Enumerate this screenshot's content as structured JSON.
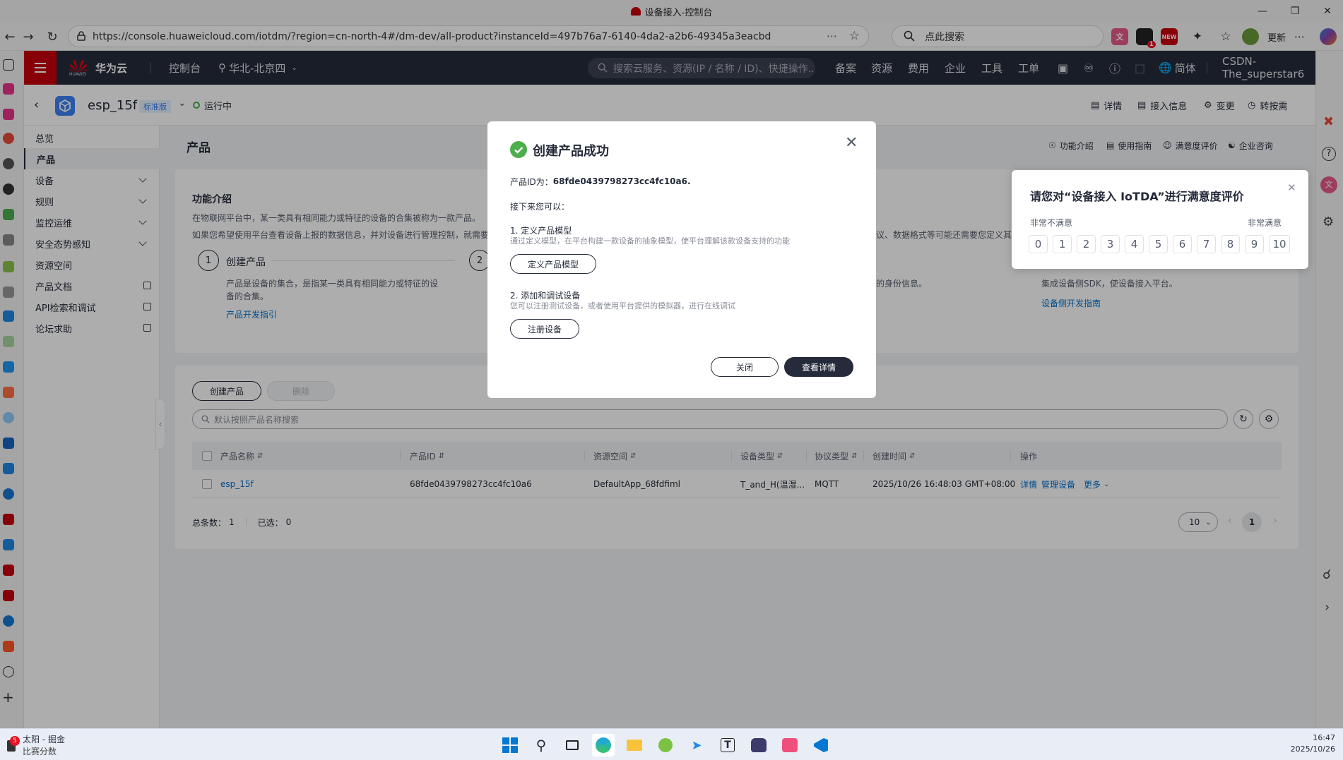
{
  "window": {
    "title": "设备接入-控制台"
  },
  "browser": {
    "url": "https://console.huaweicloud.com/iotdm/?region=cn-north-4#/dm-dev/all-product?instanceId=497b76a7-6140-4da2-a2b6-49345a3eacbd",
    "search_placeholder": "点此搜索",
    "update_label": "更新",
    "ext_new_badge": "NEW",
    "ext_count_badge": "1"
  },
  "console_header": {
    "brand": "华为云",
    "brand_sub": "HUAWEI",
    "console_label": "控制台",
    "region": "华北-北京四",
    "search_placeholder": "搜索云服务、资源(IP / 名称 / ID)、快捷操作...",
    "nav": [
      "备案",
      "资源",
      "费用",
      "企业",
      "工具",
      "工单"
    ],
    "lang": "简体",
    "user": "CSDN-The_superstar6"
  },
  "instance": {
    "name": "esp_15f",
    "edition_badge": "标准版",
    "status": "运行中",
    "actions": [
      "详情",
      "接入信息",
      "变更",
      "转按需"
    ]
  },
  "sidebar": {
    "items": [
      {
        "label": "总览"
      },
      {
        "label": "产品"
      },
      {
        "label": "设备"
      },
      {
        "label": "规则"
      },
      {
        "label": "监控运维"
      },
      {
        "label": "安全态势感知"
      },
      {
        "label": "资源空间"
      },
      {
        "label": "产品文档"
      },
      {
        "label": "API检索和调试"
      },
      {
        "label": "论坛求助"
      }
    ]
  },
  "page": {
    "title": "产品",
    "header_links": [
      "功能介绍",
      "使用指南",
      "满意度评价",
      "企业咨询"
    ]
  },
  "intro": {
    "title": "功能介绍",
    "desc1": "在物联网平台中，某一类具有相同能力或特征的设备的合集被称为一款产品。",
    "desc2": "如果您希望使用平台查看设备上报的数据信息，并对设备进行管理控制，就需要",
    "desc2_tail": "议、数据格式等可能还需要您定义其他",
    "step1_num": "1",
    "step1_title": "创建产品",
    "step1_desc": "产品是设备的集合，是指某一类具有相同能力或特征的设备的合集。",
    "step1_link": "产品开发指引",
    "step2_num": "2",
    "step3_tail": "的身份信息。",
    "step4_desc": "集成设备侧SDK，使设备接入平台。",
    "step4_link": "设备侧开发指南"
  },
  "products": {
    "create_button": "创建产品",
    "delete_button": "删除",
    "search_placeholder": "默认按照产品名称搜索",
    "columns": [
      "产品名称",
      "产品ID",
      "资源空间",
      "设备类型",
      "协议类型",
      "创建时间",
      "操作"
    ],
    "rows": [
      {
        "name": "esp_15f",
        "id": "68fde0439798273cc4fc10a6",
        "space": "DefaultApp_68fdfiml",
        "device_type": "T_and_H(温湿...",
        "protocol": "MQTT",
        "created": "2025/10/26 16:48:03 GMT+08:00",
        "ops": [
          "详情",
          "管理设备",
          "更多"
        ]
      }
    ],
    "total_label": "总条数：",
    "total": "1",
    "selected_label": "已选：",
    "selected": "0",
    "page_size": "10",
    "current_page": "1"
  },
  "modal": {
    "title": "创建产品成功",
    "product_id_label": "产品ID为：",
    "product_id": "68fde0439798273cc4fc10a6.",
    "next_label": "接下来您可以：",
    "step1_title": "1. 定义产品模型",
    "step1_desc": "通过定义模型，在平台构建一款设备的抽象模型，使平台理解该款设备支持的功能",
    "step1_button": "定义产品模型",
    "step2_title": "2. 添加和调试设备",
    "step2_desc": "您可以注册测试设备，或者使用平台提供的模拟器，进行在线调试",
    "step2_button": "注册设备",
    "close_button": "关闭",
    "detail_button": "查看详情"
  },
  "rating": {
    "title": "请您对“设备接入 IoTDA”进行满意度评价",
    "low_label": "非常不满意",
    "high_label": "非常满意",
    "scores": [
      "0",
      "1",
      "2",
      "3",
      "4",
      "5",
      "6",
      "7",
      "8",
      "9",
      "10"
    ]
  },
  "taskbar": {
    "weather_title": "太阳 - 掘金",
    "weather_sub": "比赛分数",
    "weather_badge": "5",
    "time": "16:47",
    "date": "2025/10/26"
  },
  "colors": {
    "accent": "#c7000b",
    "header": "#252b3a",
    "link": "#0071ce",
    "success": "#4cae4c"
  }
}
